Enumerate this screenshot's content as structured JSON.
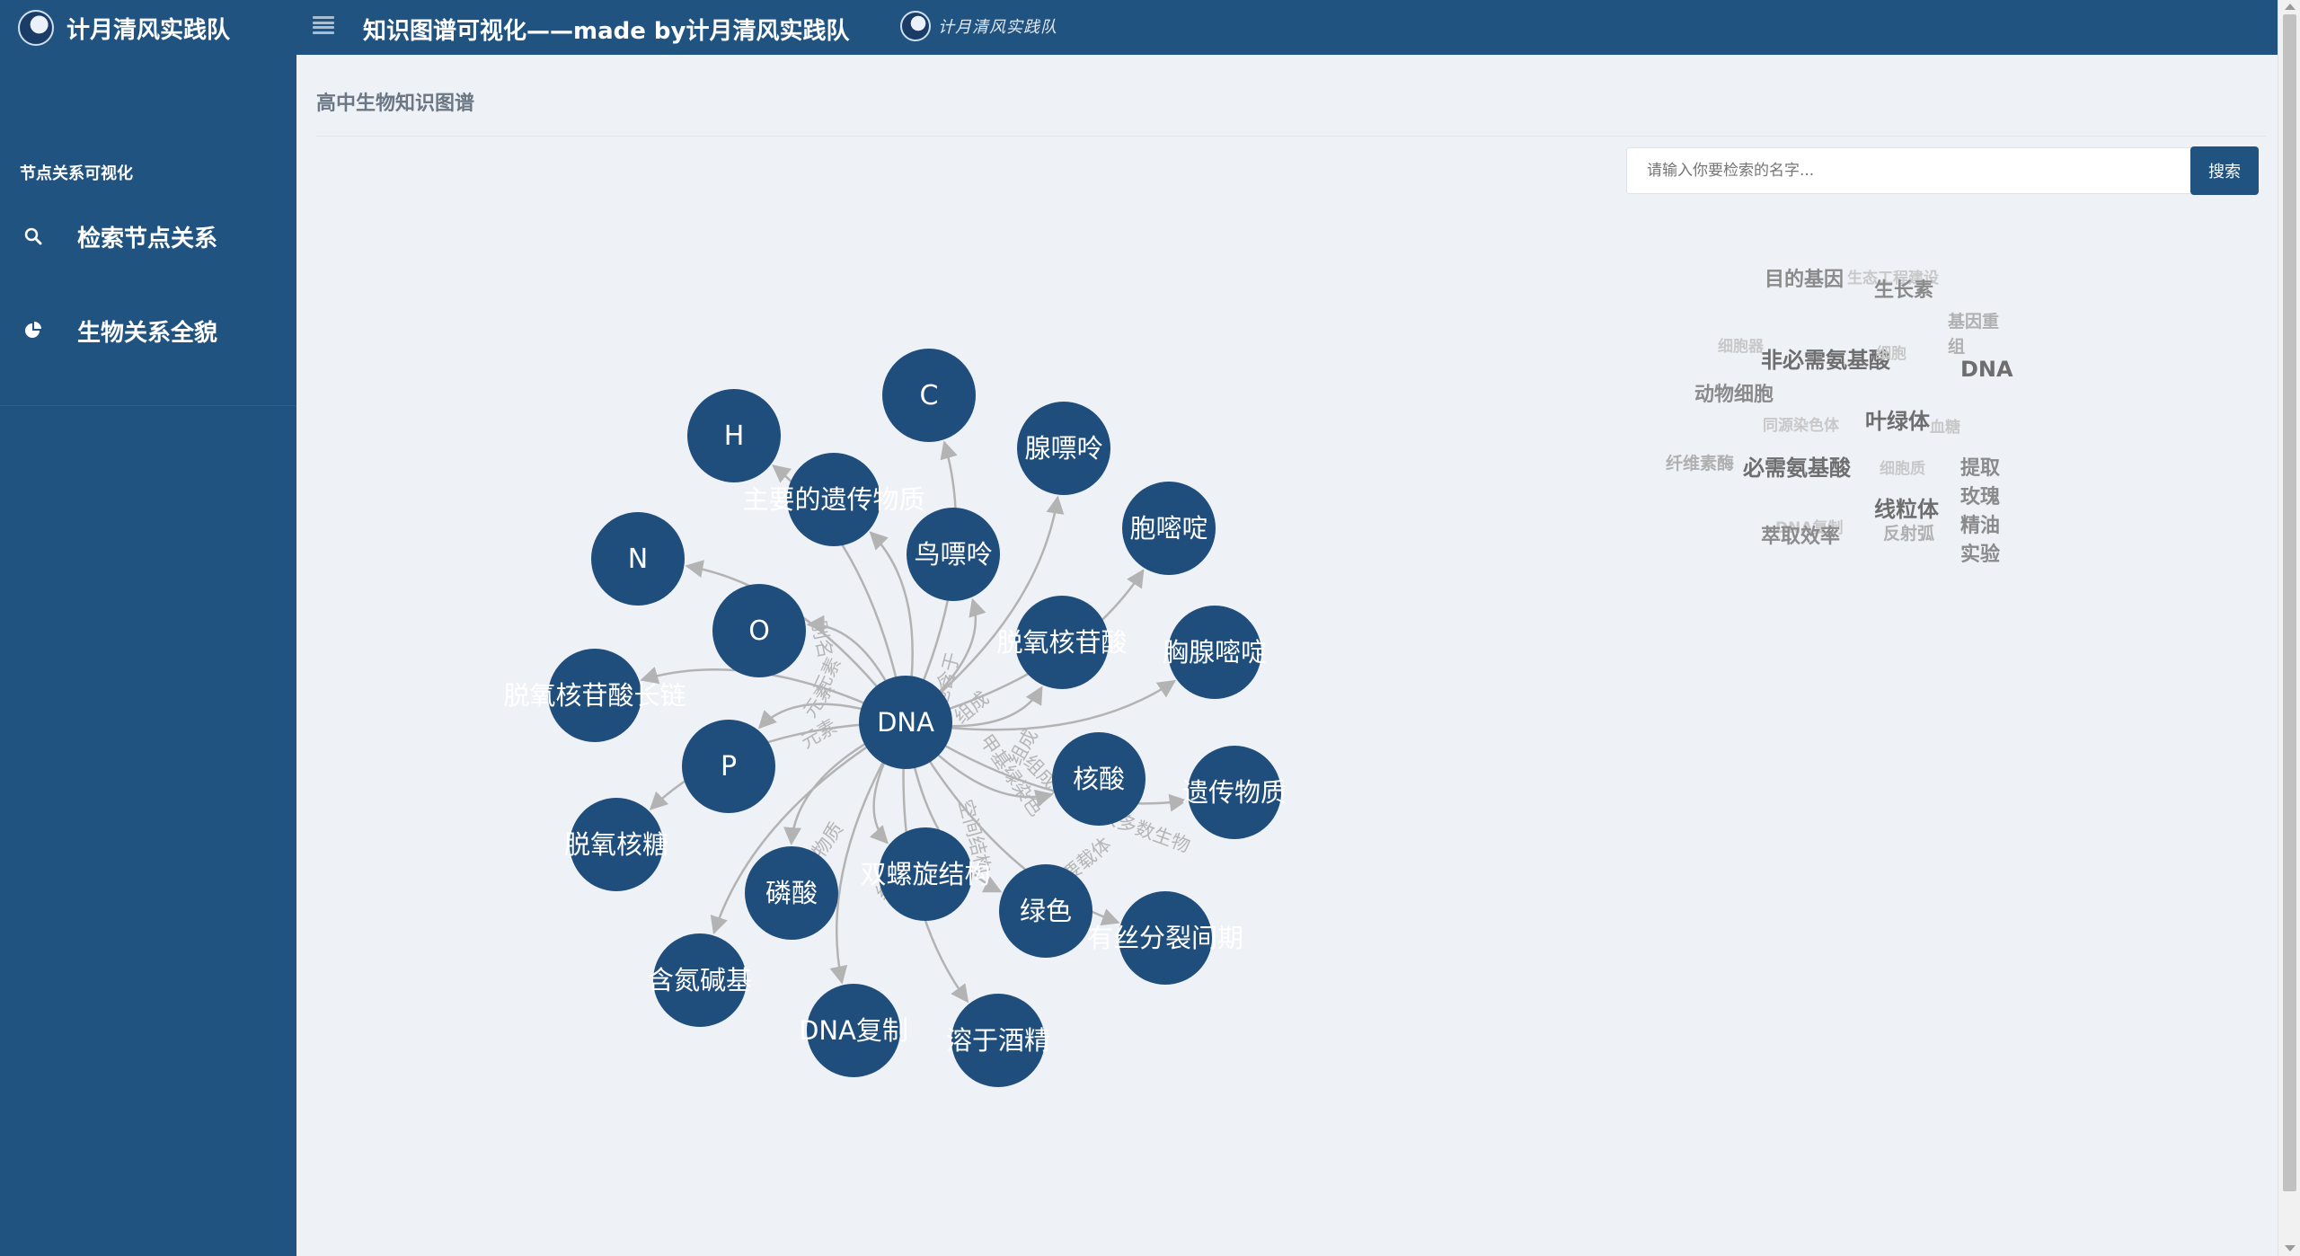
{
  "header": {
    "brand": "计月清风实践队",
    "page_title": "知识图谱可视化——made by计月清风实践队",
    "calligraphy": "计月清风实践队"
  },
  "sidebar": {
    "section": "节点关系可视化",
    "items": [
      {
        "label": "检索节点关系",
        "icon": "search-icon"
      },
      {
        "label": "生物关系全貌",
        "icon": "pie-chart-icon"
      }
    ]
  },
  "main": {
    "title": "高中生物知识图谱",
    "search": {
      "placeholder": "请输入你要检索的名字...",
      "button": "搜索"
    }
  },
  "colors": {
    "primary": "#215381",
    "node": "#1f4e7c",
    "edge": "#b3b3b3",
    "background": "#eef1f6"
  },
  "graph": {
    "center": "DNA",
    "nodes": [
      "DNA",
      "C",
      "H",
      "主要的遗传物质",
      "N",
      "O",
      "鸟嘌呤",
      "腺嘌呤",
      "胞嘧啶",
      "脱氧核苷酸",
      "胸腺嘧啶",
      "脱氧核苷酸长链",
      "P",
      "核酸",
      "遗传物质",
      "脱氧核糖",
      "磷酸",
      "双螺旋结构",
      "绿色",
      "有丝分裂间期",
      "含氮碱基",
      "DNA复制",
      "溶于酒精"
    ],
    "edge_labels": [
      "元素",
      "元素",
      "元素",
      "别名",
      "元素",
      "包含于",
      "组成",
      "组成物质",
      "组成物质",
      "组成物质",
      "空间结构",
      "甲基绿染色",
      "组成",
      "复制",
      "主要载体",
      "大多数生物"
    ]
  },
  "word_cloud": [
    {
      "text": "目的基因",
      "weight": 3
    },
    {
      "text": "生态工程建设",
      "weight": 1
    },
    {
      "text": "生长素",
      "weight": 3
    },
    {
      "text": "基因重",
      "weight": 2
    },
    {
      "text": "组",
      "weight": 2
    },
    {
      "text": "细胞器",
      "weight": 1
    },
    {
      "text": "非必需氨基酸",
      "weight": 4
    },
    {
      "text": "细胞",
      "weight": 1
    },
    {
      "text": "DNA",
      "weight": 4
    },
    {
      "text": "动物细胞",
      "weight": 3
    },
    {
      "text": "叶绿体",
      "weight": 4
    },
    {
      "text": "同源染色体",
      "weight": 1
    },
    {
      "text": "血糖",
      "weight": 1
    },
    {
      "text": "纤维素酶",
      "weight": 2
    },
    {
      "text": "必需氨基酸",
      "weight": 4
    },
    {
      "text": "细胞质",
      "weight": 1
    },
    {
      "text": "提取",
      "weight": 3
    },
    {
      "text": "玫瑰",
      "weight": 3
    },
    {
      "text": "线粒体",
      "weight": 4
    },
    {
      "text": "精油",
      "weight": 3
    },
    {
      "text": "DNA复制",
      "weight": 1
    },
    {
      "text": "萃取效率",
      "weight": 3
    },
    {
      "text": "反射弧",
      "weight": 2
    },
    {
      "text": "实验",
      "weight": 3
    }
  ]
}
